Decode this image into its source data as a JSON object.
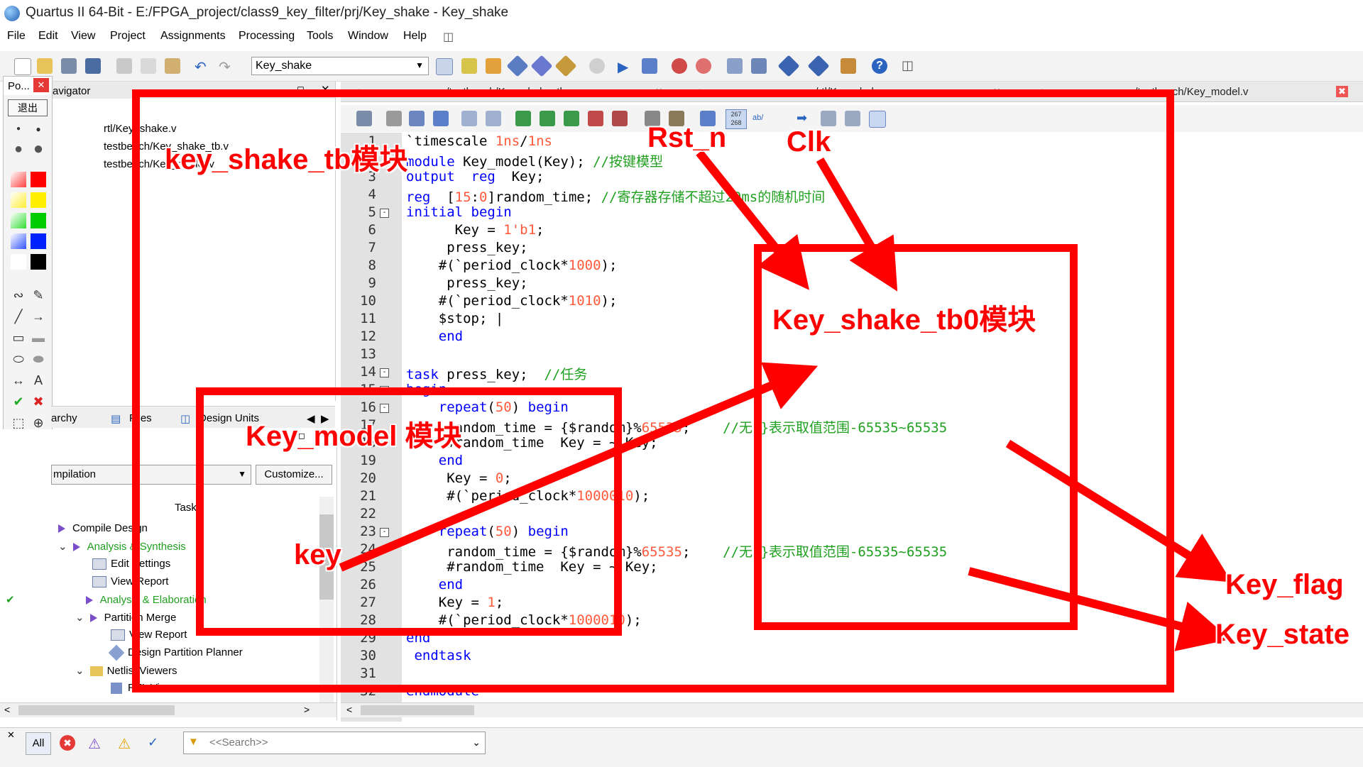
{
  "window": {
    "title": "Quartus II 64-Bit - E:/FPGA_project/class9_key_filter/prj/Key_shake - Key_shake"
  },
  "menu": [
    "File",
    "Edit",
    "View",
    "Project",
    "Assignments",
    "Processing",
    "Tools",
    "Window",
    "Help"
  ],
  "toolbar": {
    "project_select": "Key_shake"
  },
  "palette": {
    "title": "Po...",
    "exit_label": "退出"
  },
  "navigator": {
    "title": "avigator",
    "files": [
      "rtl/Key_shake.v",
      "testbench/Key_shake_tb.v",
      "testbench/Key_model.v"
    ]
  },
  "lower_tabs": {
    "hierarchy": "archy",
    "files": "Files",
    "design_units": "Design Units"
  },
  "flow": {
    "selected": "mpilation",
    "customize_label": "Customize...",
    "task_header": "Task"
  },
  "tasks": [
    {
      "label": "Compile Design",
      "done": false
    },
    {
      "label": "Analysis & Synthesis",
      "done": false
    },
    {
      "label": "Edit Settings",
      "done": false
    },
    {
      "label": "View Report",
      "done": false
    },
    {
      "label": "Analysis & Elaboration",
      "done": true
    },
    {
      "label": "Partition Merge",
      "done": false
    },
    {
      "label": "View Report",
      "done": false
    },
    {
      "label": "Design Partition Planner",
      "done": false
    },
    {
      "label": "Netlist Viewers",
      "done": false
    },
    {
      "label": "RTL Viewer",
      "done": false
    }
  ],
  "editor_tabs": [
    "../testbench/Key_shake_tb.v",
    "../rtl/Key_shake.v",
    "../testbench/Key_model.v"
  ],
  "editor_toolbar": {
    "linecol": "267 268",
    "abc": "ab/"
  },
  "code": {
    "line_numbers": [
      "1",
      "3",
      "3",
      "4",
      "5",
      "6",
      "7",
      "8",
      "9",
      "10",
      "11",
      "12",
      "13",
      "14",
      "15",
      "16",
      "17",
      "18",
      "19",
      "20",
      "21",
      "22",
      "23",
      "24",
      "25",
      "26",
      "27",
      "28",
      "29",
      "30",
      "31",
      "32"
    ],
    "lines": [
      "`timescale 1ns/1ns",
      "module Key_model(Key); //按键模型",
      "output  reg  Key;",
      "reg  [15:0]random_time; //寄存器存储不超过20ms的随机时间",
      "initial begin",
      "      Key = 1'b1;",
      "     press_key;",
      "    #(`period_clock*1000);",
      "     press_key;",
      "    #(`period_clock*1010);",
      "    $stop; |",
      "    end",
      "",
      "task press_key;  //任务",
      "begin",
      "    repeat(50) begin",
      "     random_time = {$random}%65535;    //无{}表示取值范围-65535~65535",
      "     #random_time  Key = ~ Key;",
      "    end",
      "     Key = 0;",
      "     #(`period_clock*1000010);",
      "",
      "    repeat(50) begin",
      "     random_time = {$random}%65535;    //无{}表示取值范围-65535~65535",
      "     #random_time  Key = ~ Key;",
      "    end",
      "    Key = 1;",
      "    #(`period_clock*1000010);",
      "end",
      " endtask",
      "",
      "endmodule"
    ]
  },
  "messages": {
    "all_label": "All",
    "search_placeholder": "<<Search>>"
  },
  "annotations": {
    "key_shake_tb": "key_shake_tb模块",
    "key_shake_tb0": "Key_shake_tb0模块",
    "key_model": "Key_model 模块",
    "rst_n": "Rst_n",
    "clk": "Clk",
    "key": "key",
    "key_flag": "Key_flag",
    "key_state": "Key_state",
    "color": "#ff0000"
  }
}
